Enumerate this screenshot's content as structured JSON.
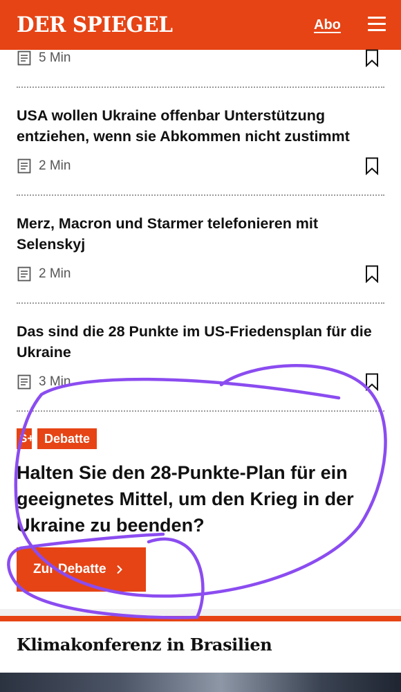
{
  "header": {
    "logo": "DER SPIEGEL",
    "abo_label": "Abo",
    "menu_icon": "hamburger-menu-icon"
  },
  "articles": [
    {
      "headline": "",
      "read_time": "5 Min"
    },
    {
      "headline": "USA wollen Ukraine offenbar Unterstützung entziehen, wenn sie Abkommen nicht zustimmt",
      "read_time": "2 Min"
    },
    {
      "headline": "Merz, Macron und Starmer telefonieren mit Selenskyj",
      "read_time": "2 Min"
    },
    {
      "headline": "Das sind die 28 Punkte im US-Friedensplan für die Ukraine",
      "read_time": "3 Min"
    }
  ],
  "debate": {
    "plus_badge": "S+",
    "badge": "Debatte",
    "question": "Halten Sie den 28-Punkte-Plan für ein geeignetes Mittel, um den Krieg in der Ukraine zu beenden?",
    "button_label": "Zur Debatte",
    "button_icon": "chevron-right-icon"
  },
  "section": {
    "title": "Klimakonferenz in Brasilien"
  },
  "colors": {
    "brand": "#e64415",
    "annotation": "#8b4cf0"
  }
}
